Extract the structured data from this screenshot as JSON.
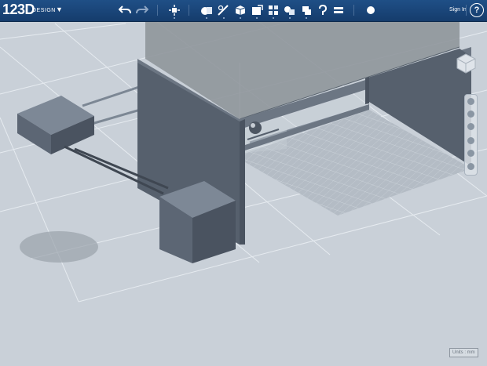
{
  "app": {
    "brand": "123D",
    "brand_sub": "DESIGN"
  },
  "toolbar": {
    "undo": "undo",
    "redo": "redo",
    "tools": [
      "transform-icon",
      "primitives-icon",
      "sketch-icon",
      "construct-icon",
      "modify-icon",
      "pattern-icon",
      "group-icon",
      "combine-icon",
      "measure-icon",
      "text-icon",
      "material-icon"
    ],
    "sign_in": "Sign In",
    "help": "?"
  },
  "statusbar": {
    "units": "Units : mm"
  },
  "colors": {
    "toolbar": "#1a4677",
    "body": "#5a6575",
    "glass": "#8f969b",
    "floor": "#c9d0d8"
  }
}
